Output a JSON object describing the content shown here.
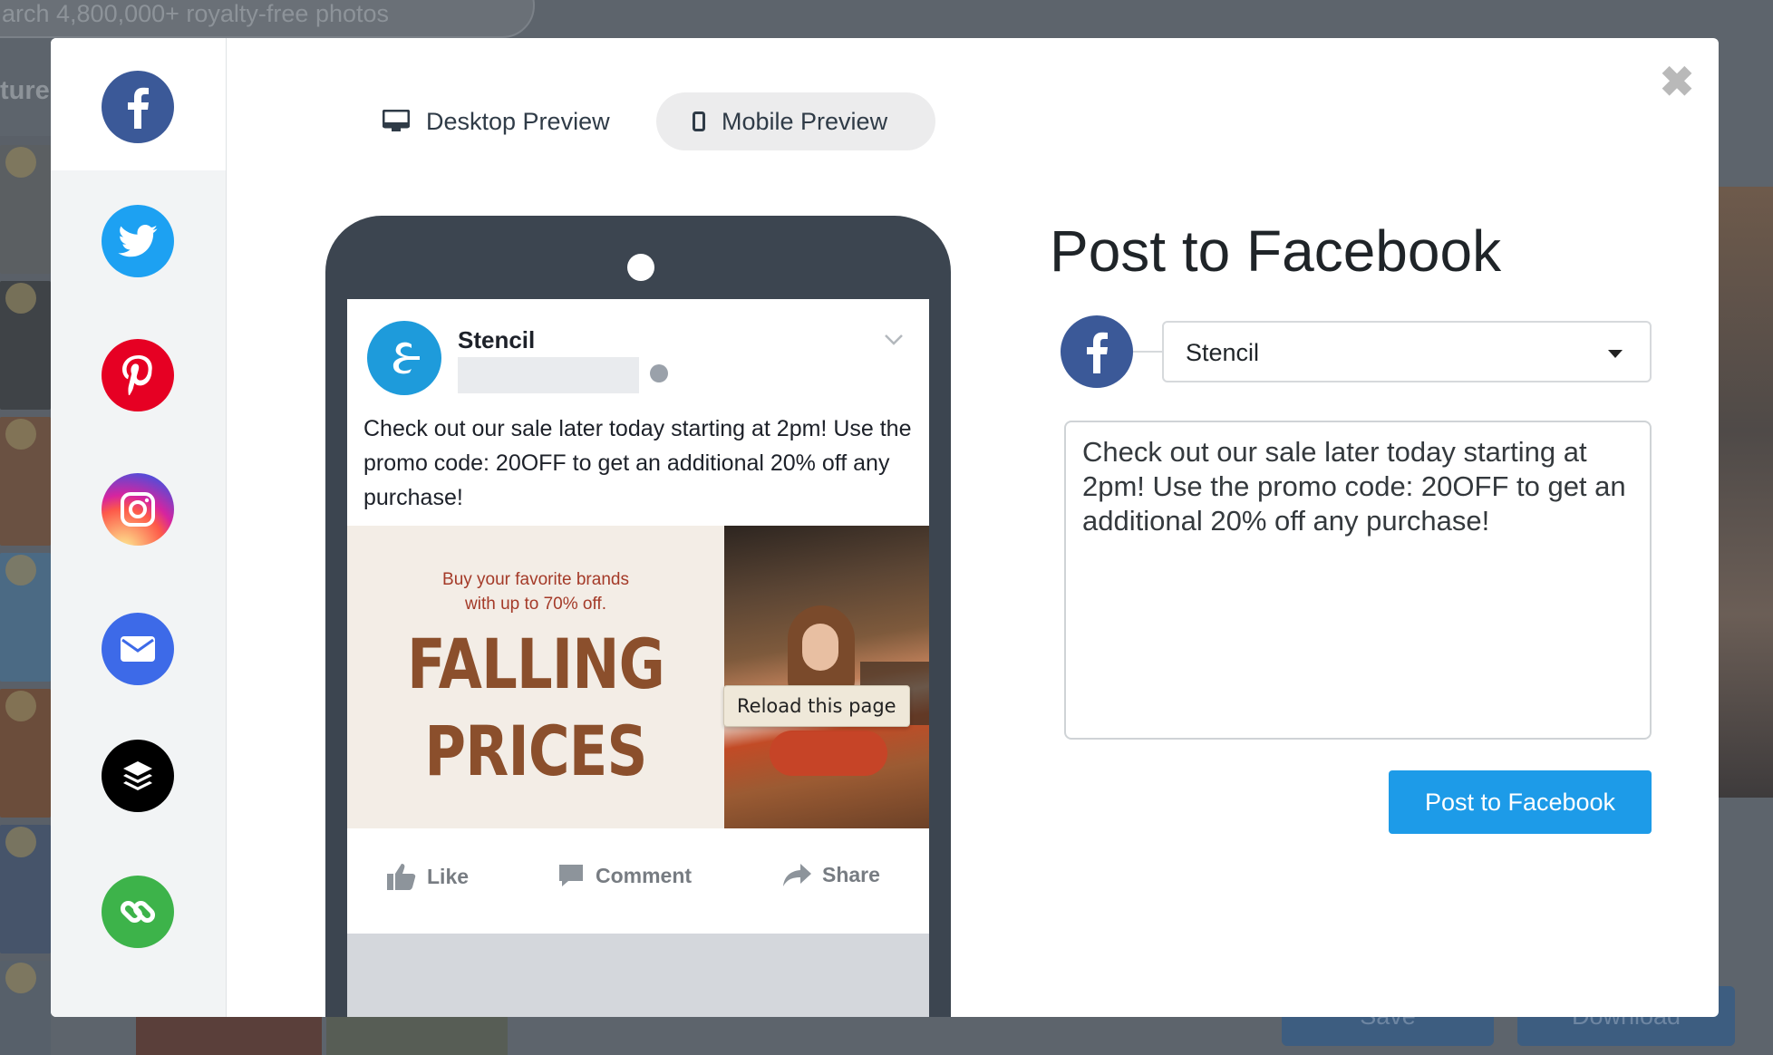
{
  "background": {
    "search_placeholder": "arch 4,800,000+ royalty-free photos",
    "section_label": "ture",
    "save_label": "Save",
    "download_label": "Download"
  },
  "modal": {
    "close_glyph": "✖",
    "networks": [
      {
        "name": "facebook",
        "color": "#3b5998",
        "active": true
      },
      {
        "name": "twitter",
        "color": "#1da1f2"
      },
      {
        "name": "pinterest",
        "color": "#e60023"
      },
      {
        "name": "instagram",
        "color": "#d6249f"
      },
      {
        "name": "email",
        "color": "#3d6ae8"
      },
      {
        "name": "buffer",
        "color": "#000000"
      },
      {
        "name": "link",
        "color": "#3db34a"
      }
    ],
    "tabs": {
      "desktop": "Desktop Preview",
      "mobile": "Mobile Preview",
      "active": "mobile"
    },
    "preview": {
      "page_name": "Stencil",
      "post_text": "Check out our sale later today starting at 2pm! Use the promo code: 20OFF to get an additional 20% off any purchase!",
      "ad_subline_1": "Buy your favorite brands",
      "ad_subline_2": "with up to 70% off.",
      "ad_headline_1": "FALLING",
      "ad_headline_2": "PRICES",
      "tooltip": "Reload this page",
      "actions": {
        "like": "Like",
        "comment": "Comment",
        "share": "Share"
      }
    },
    "panel": {
      "title": "Post to Facebook",
      "account_selected": "Stencil",
      "message": "Check out our sale later today starting at 2pm! Use the promo code: 20OFF to get an additional 20% off any purchase!",
      "submit_label": "Post to Facebook"
    }
  }
}
